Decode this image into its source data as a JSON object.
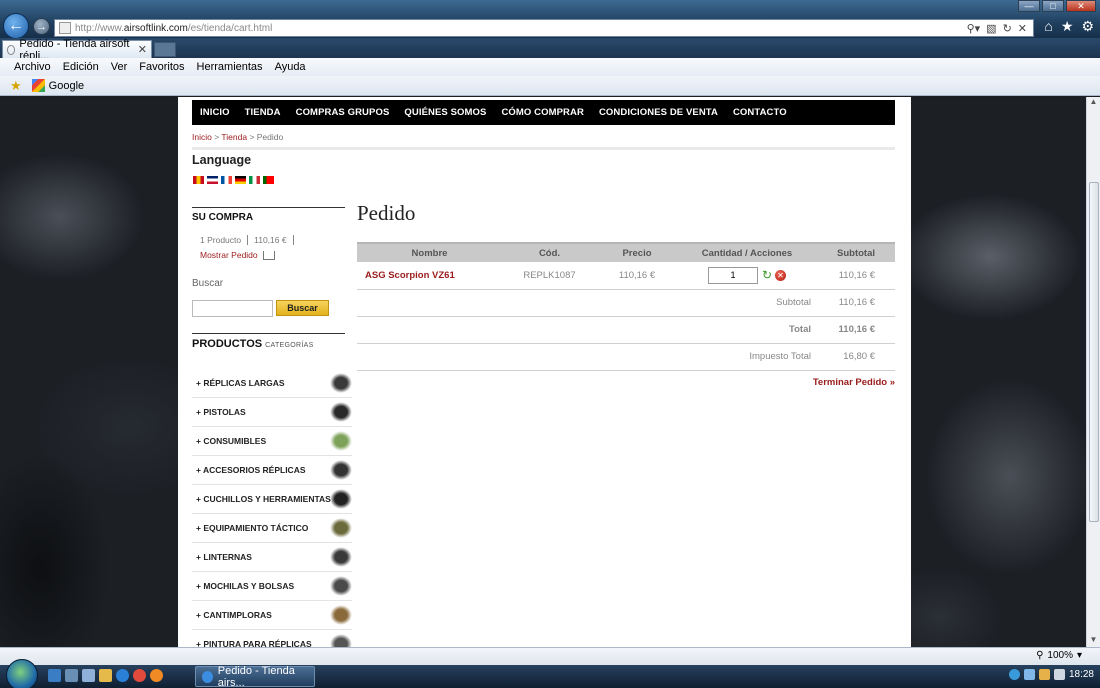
{
  "browser": {
    "url_prefix": "http://www.",
    "url_domain": "airsoftlink.com",
    "url_path": "/es/tienda/cart.html",
    "tab_title": "Pedido - Tienda airsoft répli...",
    "menu": [
      "Archivo",
      "Edición",
      "Ver",
      "Favoritos",
      "Herramientas",
      "Ayuda"
    ],
    "favorites": [
      "Google"
    ],
    "zoom": "100%"
  },
  "site": {
    "nav": [
      "INICIO",
      "TIENDA",
      "COMPRAS GRUPOS",
      "QUIÉNES SOMOS",
      "CÓMO COMPRAR",
      "CONDICIONES DE VENTA",
      "CONTACTO"
    ],
    "breadcrumb": {
      "home": "Inicio",
      "sep1": " > ",
      "shop": "Tienda",
      "sep2": " > ",
      "current": "Pedido"
    },
    "language_title": "Language",
    "flags": [
      {
        "name": "spanish-flag",
        "colors": [
          "#c60b1e",
          "#ffc400",
          "#c60b1e"
        ]
      },
      {
        "name": "english-flag",
        "colors": [
          "#012169",
          "#ffffff",
          "#c8102e"
        ]
      },
      {
        "name": "french-flag",
        "colors": [
          "#0055a4",
          "#ffffff",
          "#ef4135"
        ]
      },
      {
        "name": "german-flag",
        "colors": [
          "#000000",
          "#dd0000",
          "#ffce00"
        ]
      },
      {
        "name": "italian-flag",
        "colors": [
          "#009246",
          "#ffffff",
          "#ce2b37"
        ]
      },
      {
        "name": "portuguese-flag",
        "colors": [
          "#006600",
          "#ff0000",
          "#ff0000"
        ]
      }
    ]
  },
  "sidebar": {
    "purchase_title": "SU COMPRA",
    "item_count": "1 Producto",
    "item_total": "110,16 €",
    "show_order": "Mostrar Pedido",
    "search_label": "Buscar",
    "search_button": "Buscar",
    "products_title": "PRODUCTOS",
    "products_subtitle": "CATEGORÍAS",
    "categories": [
      {
        "label": "+ RÉPLICAS LARGAS",
        "color": "#3a3a3a"
      },
      {
        "label": "+ PISTOLAS",
        "color": "#2a2a2a"
      },
      {
        "label": "+ CONSUMIBLES",
        "color": "#7ea25a"
      },
      {
        "label": "+ ACCESORIOS RÉPLICAS",
        "color": "#333333"
      },
      {
        "label": "+ CUCHILLOS Y HERRAMIENTAS",
        "color": "#222222"
      },
      {
        "label": "+ EQUIPAMIENTO TÁCTICO",
        "color": "#6b6a3a"
      },
      {
        "label": "+ LINTERNAS",
        "color": "#3a3a3a"
      },
      {
        "label": "+ MOCHILAS Y BOLSAS",
        "color": "#4a4a4a"
      },
      {
        "label": "+ CANTIMPLORAS",
        "color": "#8a6a3a"
      },
      {
        "label": "+ PINTURA PARA RÉPLICAS",
        "color": "#555555"
      }
    ]
  },
  "main": {
    "title": "Pedido",
    "columns": [
      "Nombre",
      "Cód.",
      "Precio",
      "Cantidad / Acciones",
      "Subtotal"
    ],
    "items": [
      {
        "name": "ASG Scorpion VZ61",
        "code": "REPLK1087",
        "price": "110,16 €",
        "qty": "1",
        "subtotal": "110,16 €"
      }
    ],
    "subtotal_label": "Subtotal",
    "subtotal_value": "110,16 €",
    "total_label": "Total",
    "total_value": "110,16 €",
    "tax_label": "Impuesto Total",
    "tax_value": "16,80 €",
    "finish_link": "Terminar Pedido »"
  },
  "taskbar": {
    "window_button": "Pedido - Tienda airs...",
    "clock": "18:28"
  }
}
